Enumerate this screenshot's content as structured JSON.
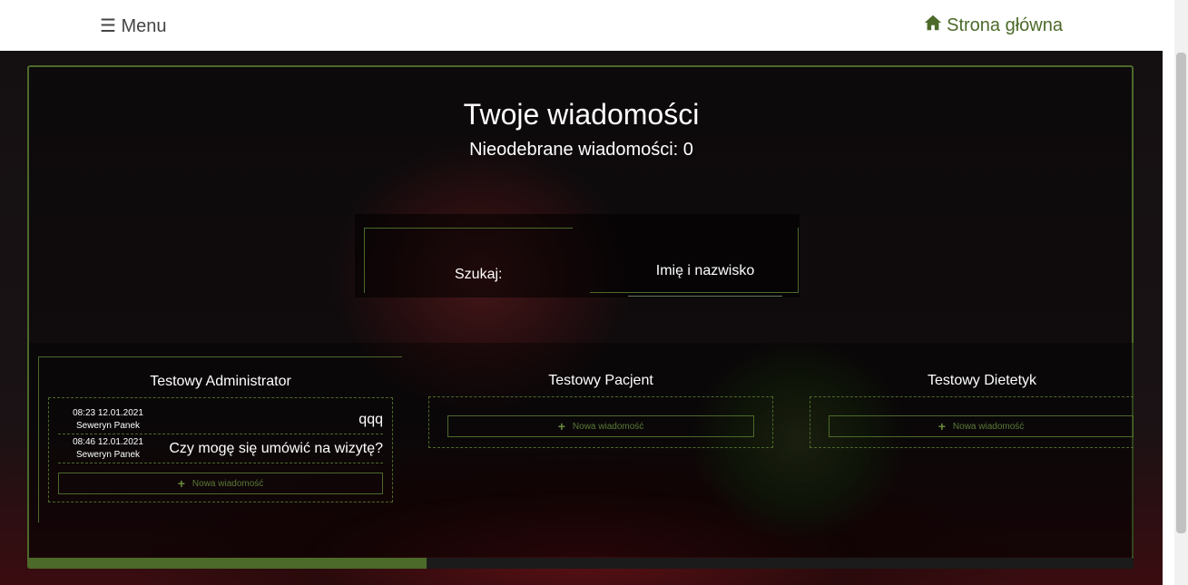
{
  "header": {
    "menu_label": "☰ Menu",
    "home_label": "Strona główna",
    "home_icon": "home-icon",
    "accent_color": "#4c6a2a"
  },
  "main": {
    "title": "Twoje wiadomości",
    "unread_label": "Nieodebrane wiadomości: 0"
  },
  "search": {
    "label": "Szukaj:",
    "placeholder": "Imię i nazwisko"
  },
  "contacts": [
    {
      "name": "Testowy Administrator",
      "messages": [
        {
          "time": "08:23 12.01.2021",
          "author": "Seweryn Panek",
          "text": "qqq"
        },
        {
          "time": "08:46 12.01.2021",
          "author": "Seweryn Panek",
          "text": "Czy mogę się umówić na wizytę?"
        }
      ],
      "new_message_label": "Nowa wiadomość"
    },
    {
      "name": "Testowy Pacjent",
      "messages": [],
      "new_message_label": "Nowa wiadomość"
    },
    {
      "name": "Testowy Dietetyk",
      "messages": [],
      "new_message_label": "Nowa wiadomość"
    }
  ],
  "scroll_progress": 0.36
}
